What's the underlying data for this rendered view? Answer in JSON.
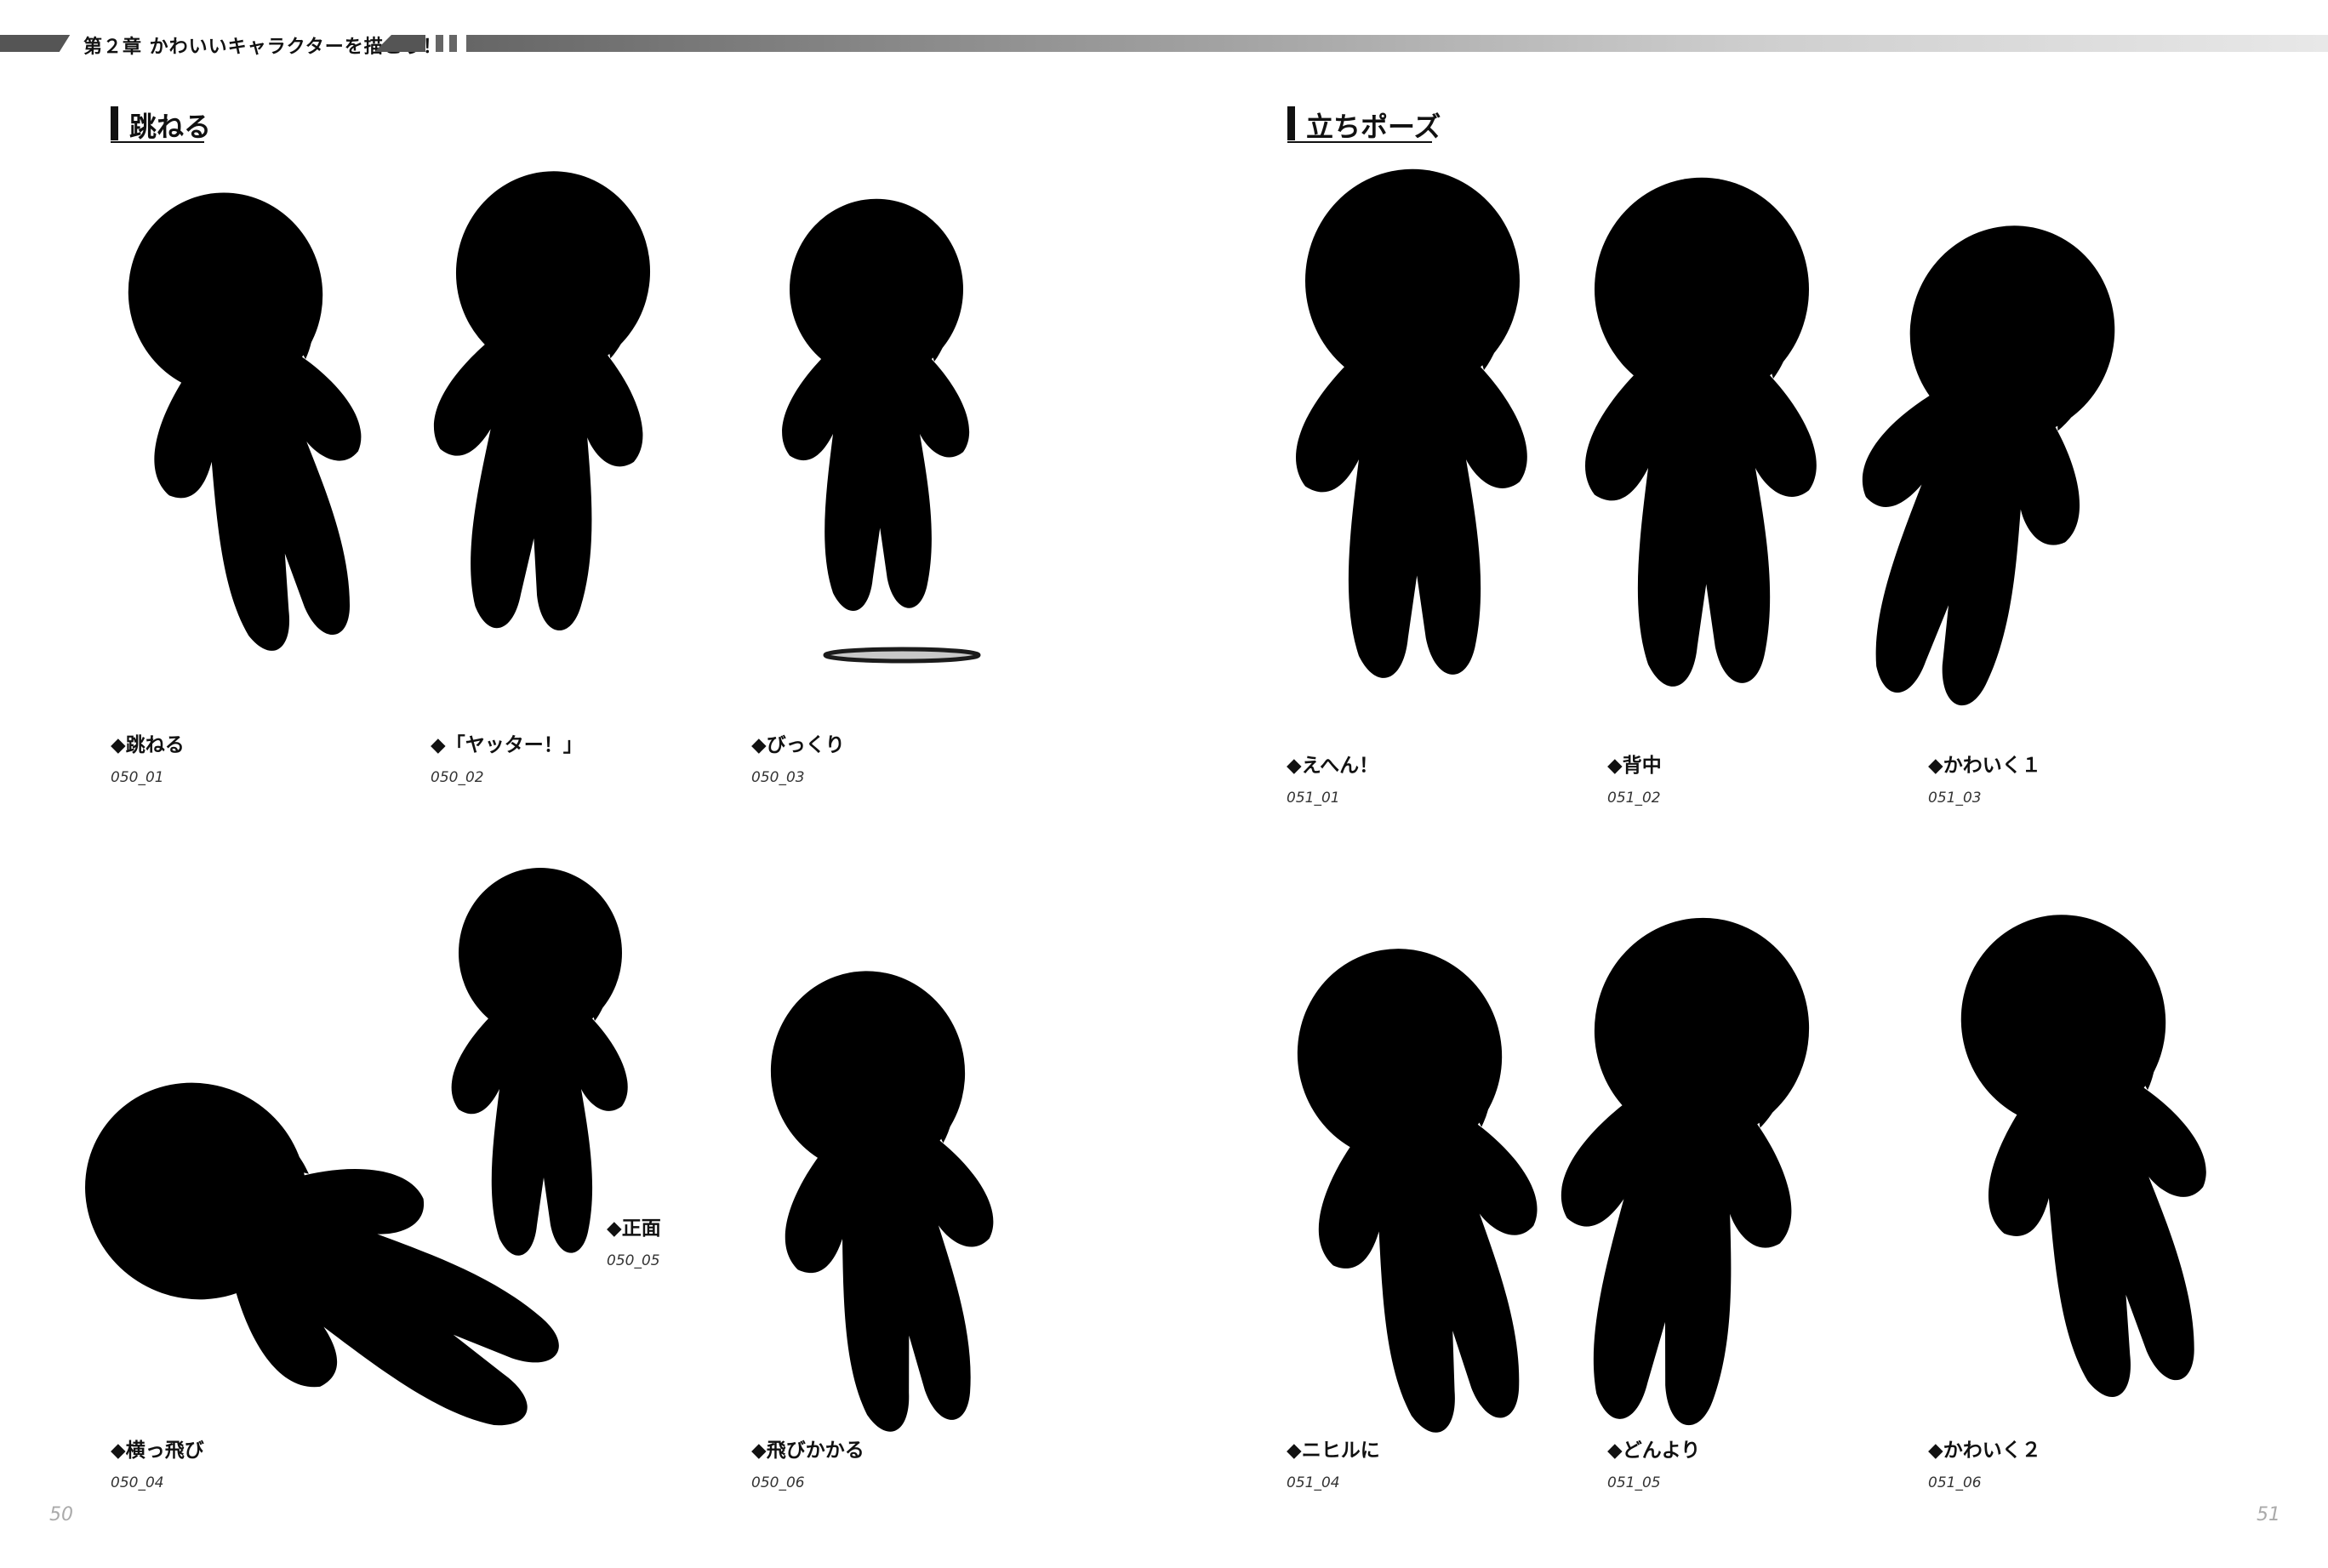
{
  "header": {
    "chapter_title": "第２章 かわいいキャラクターを描こう！"
  },
  "sections": [
    {
      "id": "left",
      "title": "跳ねる"
    },
    {
      "id": "right",
      "title": "立ちポーズ"
    }
  ],
  "poses": [
    {
      "title": "◆跳ねる",
      "code": "050_01"
    },
    {
      "title": "◆「ヤッター！」",
      "code": "050_02"
    },
    {
      "title": "◆びっくり",
      "code": "050_03"
    },
    {
      "title": "◆横っ飛び",
      "code": "050_04"
    },
    {
      "title": "◆正面",
      "code": "050_05"
    },
    {
      "title": "◆飛びかかる",
      "code": "050_06"
    },
    {
      "title": "◆えへん！",
      "code": "051_01"
    },
    {
      "title": "◆背中",
      "code": "051_02"
    },
    {
      "title": "◆かわいく１",
      "code": "051_03"
    },
    {
      "title": "◆ニヒルに",
      "code": "051_04"
    },
    {
      "title": "◆どんより",
      "code": "051_05"
    },
    {
      "title": "◆かわいく２",
      "code": "051_06"
    }
  ],
  "page_numbers": {
    "left": "50",
    "right": "51"
  }
}
